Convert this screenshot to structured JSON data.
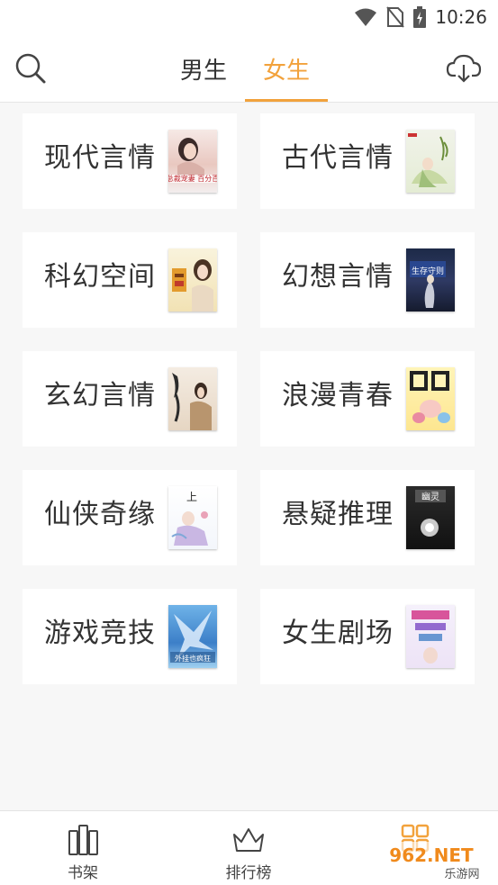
{
  "status_bar": {
    "time": "10:26"
  },
  "header": {
    "tabs": [
      {
        "label": "男生"
      },
      {
        "label": "女生"
      }
    ],
    "active_tab": "女生"
  },
  "categories": [
    {
      "label": "现代言情",
      "cover_text": "总裁宠妻 百分百"
    },
    {
      "label": "古代言情",
      "cover_text": ""
    },
    {
      "label": "科幻空间",
      "cover_text": ""
    },
    {
      "label": "幻想言情",
      "cover_text": "生存守则"
    },
    {
      "label": "玄幻言情",
      "cover_text": ""
    },
    {
      "label": "浪漫青春",
      "cover_text": ""
    },
    {
      "label": "仙侠奇缘",
      "cover_text": ""
    },
    {
      "label": "悬疑推理",
      "cover_text": "幽灵"
    },
    {
      "label": "游戏竞技",
      "cover_text": "外挂也疯狂"
    },
    {
      "label": "女生剧场",
      "cover_text": ""
    }
  ],
  "bottom_nav": [
    {
      "label": "书架",
      "icon": "bookshelf-icon"
    },
    {
      "label": "排行榜",
      "icon": "crown-icon"
    },
    {
      "label": "",
      "icon": "grid-icon"
    }
  ],
  "watermark": {
    "text_top": "962.NET",
    "text_bottom": "乐游网"
  },
  "colors": {
    "accent": "#f2a23c",
    "text": "#333333",
    "background": "#f7f7f7"
  }
}
